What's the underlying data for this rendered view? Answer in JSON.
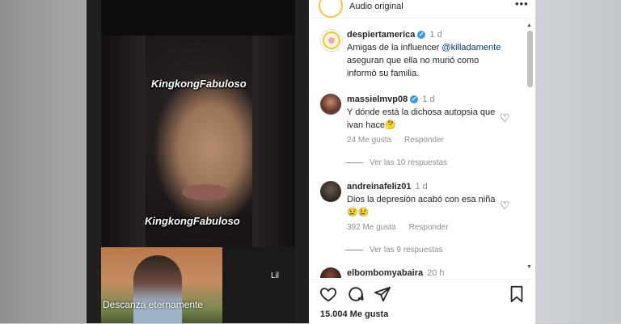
{
  "header": {
    "audio_label": "Audio original",
    "more_icon": "more-icon"
  },
  "caption": {
    "username": "despiertamerica",
    "time": "1 d",
    "text_before": "Amigas de la influencer ",
    "mention": "@killadamente",
    "text_after": " aseguran que ella no murió como informó su familia."
  },
  "comments": [
    {
      "username": "massielmvp08",
      "time": "1 d",
      "text": "Y dónde está la dichosa autopsia que ivan hace🤔",
      "likes": "24 Me gusta",
      "reply": "Responder",
      "view_replies": "Ver las 10 respuestas"
    },
    {
      "username": "andreinafeliz01",
      "time": "1 d",
      "text": "Dios la depresión acabó con esa niña 😢😢",
      "likes": "392 Me gusta",
      "reply": "Responder",
      "view_replies": "Ver las 9 respuestas"
    },
    {
      "username": "elbombomyabaira",
      "time": "20 h"
    }
  ],
  "media": {
    "overlay_1": "KingkongFabuloso",
    "overlay_2": "KingkongFabuloso",
    "thumb_caption": "Descanza eternamente",
    "side_tag": "Lil"
  },
  "actions": {
    "likes_count": "15.004",
    "likes_label": "Me gusta"
  },
  "colors": {
    "link": "#00376b",
    "verified": "#3897f0",
    "muted": "#8e8e8e"
  }
}
